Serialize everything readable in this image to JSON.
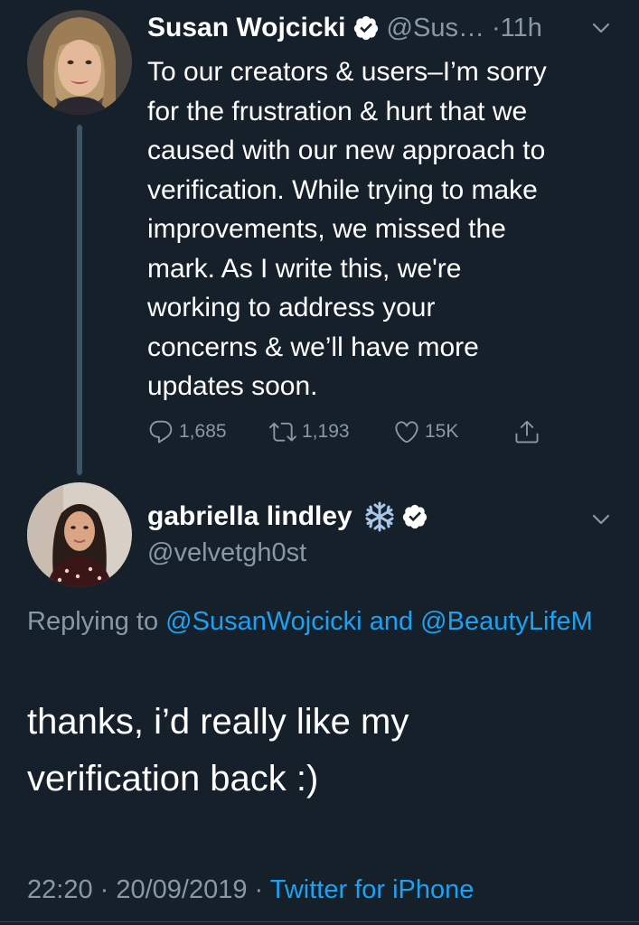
{
  "parent_tweet": {
    "display_name": "Susan Wojcicki",
    "handle_truncated": "@Sus…",
    "time_sep": "·11h",
    "text": "To our creators & users–I’m sorry\nfor the frustration & hurt that we\ncaused with our new approach to\nverification. While trying to make\nimprovements, we missed the\nmark. As I write this, we're\nworking to address your\nconcerns & we’ll have more\nupdates soon.",
    "actions": {
      "replies": "1,685",
      "retweets": "1,193",
      "likes": "15K"
    }
  },
  "reply_tweet": {
    "display_name": "gabriella lindley",
    "handle": "@velvetgh0st",
    "replying_prefix": "Replying to",
    "mention_1": "@SusanWojcicki",
    "replying_joiner": "and",
    "mention_2": "@BeautyLifeM",
    "text": "thanks, i’d really like my\nverification back :)",
    "timestamp": "22:20 · 20/09/2019 ·",
    "source": "Twitter for iPhone"
  },
  "colors": {
    "background": "#15202b",
    "text_primary": "#ffffff",
    "text_secondary": "#8899a6",
    "accent": "#1da1f2",
    "thread_line": "#3d5466"
  },
  "icons": [
    "verified-badge-icon",
    "chevron-down-icon",
    "reply-icon",
    "retweet-icon",
    "like-icon",
    "share-icon",
    "snowflake-icon"
  ]
}
